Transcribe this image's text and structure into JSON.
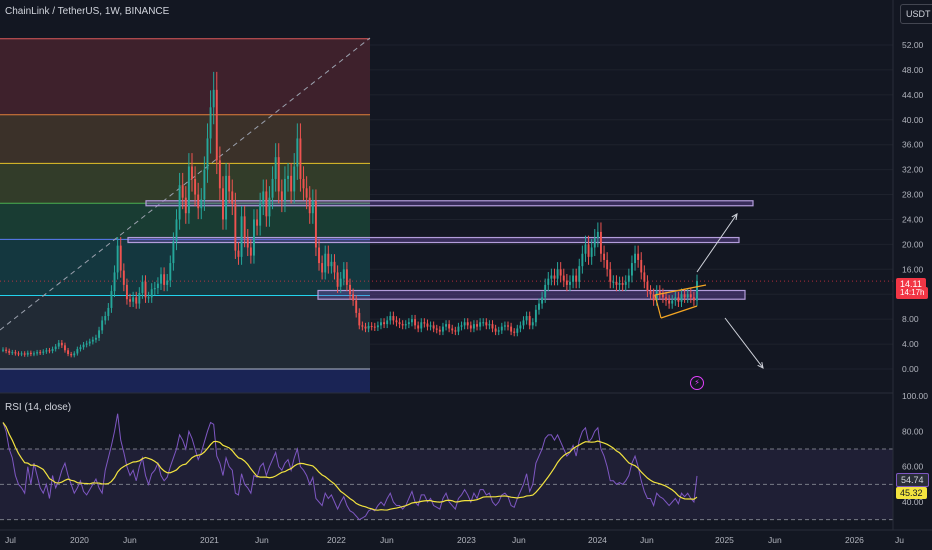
{
  "header": {
    "title": "ChainLink / TetherUS, 1W, BINANCE",
    "currency": "USDT"
  },
  "rsi": {
    "title": "RSI (14, close)",
    "value_label": "54.74",
    "ma_label": "45.32"
  },
  "price": {
    "last_label": "14.11",
    "countdown_label": "14:17h"
  },
  "colors": {
    "background": "#131722",
    "up": "#26a69a",
    "down": "#ef5350",
    "rsi_line": "#7e57c2",
    "rsi_ma": "#f2e33f",
    "box_border": "#b39ddb",
    "trend": "#f5a623",
    "accent": "#e040fb"
  },
  "chart_data": {
    "type": "candlestick",
    "x_tick_labels": [
      "Jul",
      "2020",
      "Jun",
      "2021",
      "Jun",
      "2022",
      "Jun",
      "2023",
      "Jun",
      "2024",
      "Jun",
      "2025",
      "Jun",
      "2026",
      "Ju"
    ],
    "y_tick_labels": [
      "52.00",
      "48.00",
      "44.00",
      "40.00",
      "36.00",
      "32.00",
      "28.00",
      "24.00",
      "20.00",
      "16.00",
      "12.00",
      "8.00",
      "4.00",
      "0.00"
    ],
    "ylim": [
      -1,
      55
    ],
    "rsi_tick_labels": [
      "100.00",
      "80.00",
      "60.00",
      "40.00"
    ],
    "rsi_ylim": [
      30,
      100
    ],
    "last_price": 14.11,
    "rsi_last": 54.74,
    "rsi_ma_last": 45.32,
    "fib_levels": [
      0.0,
      11.8,
      20.8,
      26.6,
      33.0,
      40.8,
      53.0
    ],
    "key_zones": [
      {
        "low": 26.2,
        "high": 27.0
      },
      {
        "low": 20.3,
        "high": 21.1
      },
      {
        "low": 11.2,
        "high": 12.6
      }
    ],
    "weekly_closes": [
      3.1,
      2.9,
      2.6,
      2.7,
      2.5,
      2.4,
      2.5,
      2.3,
      2.6,
      2.4,
      2.5,
      2.7,
      2.6,
      2.8,
      3.0,
      2.9,
      3.2,
      3.6,
      4.2,
      3.8,
      3.0,
      2.4,
      2.2,
      2.5,
      3.2,
      3.5,
      3.9,
      4.1,
      4.4,
      4.7,
      5.0,
      6.2,
      7.8,
      8.5,
      9.8,
      12.5,
      15.5,
      19.8,
      15.8,
      13.5,
      11.2,
      10.8,
      11.5,
      10.5,
      12.2,
      14.0,
      11.5,
      11.5,
      12.8,
      13.0,
      13.7,
      15.2,
      13.5,
      14.2,
      17.0,
      20.5,
      24.0,
      29.5,
      27.5,
      25.0,
      32.5,
      30.5,
      28.0,
      25.8,
      27.2,
      32.0,
      37.0,
      42.0,
      44.8,
      33.5,
      29.0,
      24.0,
      31.0,
      28.5,
      26.5,
      19.0,
      18.0,
      24.5,
      21.0,
      19.5,
      18.2,
      24.0,
      23.0,
      26.5,
      28.5,
      24.5,
      27.5,
      30.5,
      34.0,
      28.5,
      27.0,
      30.5,
      31.0,
      28.5,
      32.5,
      37.0,
      30.5,
      29.0,
      27.5,
      25.0,
      27.0,
      19.5,
      17.0,
      15.5,
      18.5,
      16.5,
      17.2,
      15.5,
      13.2,
      14.5,
      16.0,
      13.5,
      12.0,
      11.0,
      9.0,
      7.0,
      6.8,
      6.5,
      6.9,
      6.8,
      6.7,
      7.0,
      7.5,
      7.2,
      7.8,
      8.5,
      7.8,
      7.5,
      7.2,
      7.0,
      7.2,
      7.5,
      8.0,
      7.0,
      6.5,
      7.5,
      7.3,
      6.8,
      7.0,
      6.5,
      6.3,
      6.0,
      6.8,
      7.2,
      6.5,
      6.2,
      6.0,
      6.8,
      7.0,
      7.5,
      7.0,
      6.5,
      7.2,
      6.8,
      7.5,
      7.5,
      7.0,
      7.2,
      6.5,
      6.0,
      6.2,
      6.8,
      7.0,
      6.8,
      6.0,
      5.8,
      6.5,
      7.0,
      7.8,
      8.5,
      7.0,
      7.5,
      9.5,
      10.5,
      11.5,
      13.5,
      14.5,
      15.0,
      14.5,
      16.0,
      15.0,
      14.2,
      13.5,
      14.0,
      15.0,
      14.0,
      16.5,
      18.5,
      20.0,
      18.0,
      19.5,
      21.0,
      22.0,
      18.5,
      17.5,
      16.0,
      14.0,
      14.0,
      13.5,
      13.8,
      13.5,
      14.0,
      15.0,
      17.0,
      18.5,
      17.5,
      15.5,
      14.0,
      12.5,
      12.0,
      11.0,
      12.5,
      12.0,
      11.5,
      11.0,
      10.5,
      11.0,
      11.5,
      10.8,
      12.0,
      11.5,
      12.0,
      11.5,
      11.0,
      14.11
    ],
    "weekly_rsi": [
      85,
      80,
      70,
      65,
      55,
      50,
      48,
      45,
      60,
      50,
      62,
      55,
      48,
      45,
      50,
      42,
      55,
      48,
      52,
      58,
      62,
      55,
      50,
      45,
      48,
      52,
      46,
      44,
      47,
      50,
      53,
      48,
      45,
      58,
      65,
      72,
      80,
      90,
      75,
      68,
      60,
      55,
      58,
      52,
      60,
      65,
      55,
      50,
      56,
      58,
      62,
      55,
      52,
      54,
      60,
      65,
      70,
      78,
      75,
      70,
      80,
      76,
      70,
      64,
      68,
      74,
      80,
      85,
      84,
      66,
      62,
      55,
      65,
      60,
      58,
      45,
      44,
      56,
      50,
      48,
      45,
      55,
      54,
      60,
      62,
      55,
      60,
      64,
      68,
      60,
      58,
      62,
      64,
      58,
      65,
      70,
      60,
      58,
      55,
      50,
      54,
      42,
      40,
      38,
      45,
      42,
      44,
      40,
      36,
      40,
      43,
      38,
      35,
      34,
      32,
      30,
      31,
      32,
      35,
      36,
      35,
      38,
      40,
      38,
      42,
      45,
      40,
      38,
      38,
      36,
      38,
      42,
      46,
      40,
      38,
      44,
      44,
      40,
      42,
      38,
      37,
      36,
      42,
      45,
      40,
      38,
      36,
      42,
      44,
      47,
      44,
      40,
      45,
      42,
      47,
      47,
      44,
      45,
      40,
      38,
      40,
      44,
      45,
      43,
      38,
      37,
      42,
      46,
      50,
      56,
      46,
      50,
      62,
      66,
      70,
      76,
      78,
      78,
      75,
      78,
      74,
      70,
      66,
      68,
      72,
      66,
      75,
      80,
      82,
      74,
      76,
      80,
      82,
      70,
      66,
      60,
      52,
      52,
      50,
      51,
      50,
      52,
      55,
      62,
      66,
      60,
      52,
      46,
      42,
      42,
      38,
      45,
      43,
      42,
      40,
      38,
      40,
      42,
      39,
      45,
      43,
      45,
      42,
      40,
      54.74
    ]
  }
}
